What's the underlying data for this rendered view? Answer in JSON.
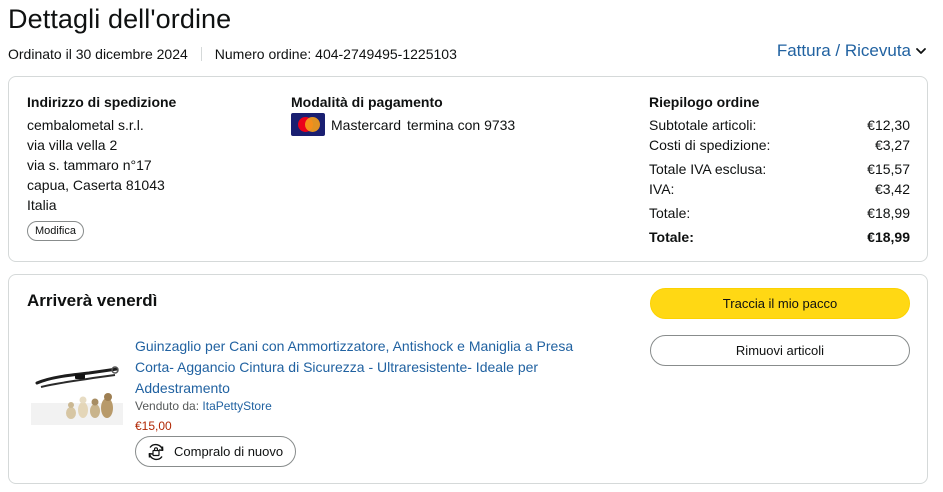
{
  "header": {
    "title": "Dettagli dell'ordine",
    "order_date": "Ordinato il 30 dicembre 2024",
    "order_number": "Numero ordine: 404-2749495-1225103",
    "invoice_link": "Fattura / Ricevuta"
  },
  "shipping": {
    "title": "Indirizzo di spedizione",
    "lines": [
      "cembalometal s.r.l.",
      "via villa vella 2",
      "via s. tammaro n°17",
      "capua, Caserta 81043",
      "Italia"
    ],
    "edit_label": "Modifica"
  },
  "payment": {
    "title": "Modalità di pagamento",
    "card_name": "Mastercard",
    "card_ending": "termina con 9733",
    "icon": "mastercard-logo"
  },
  "summary": {
    "title": "Riepilogo ordine",
    "rows": [
      {
        "label": "Subtotale articoli:",
        "value": "€12,30"
      },
      {
        "label": "Costi di spedizione:",
        "value": "€3,27"
      },
      {
        "label": "Totale IVA esclusa:",
        "value": "€15,57"
      },
      {
        "label": "IVA:",
        "value": "€3,42"
      },
      {
        "label": "Totale:",
        "value": "€18,99"
      },
      {
        "label": "Totale:",
        "value": "€18,99"
      }
    ]
  },
  "shipment": {
    "title": "Arriverà venerdì",
    "product_title": "Guinzaglio per Cani con Ammortizzatore, Antishock e Maniglia a Presa Corta- Aggancio Cintura di Sicurezza - Ultraresistente- Ideale per Addestramento",
    "sold_by_label": "Venduto da:",
    "seller": "ItaPettyStore",
    "price": "€15,00",
    "buy_again_label": "Compralo di nuovo",
    "track_label": "Traccia il mio pacco",
    "remove_label": "Rimuovi articoli"
  },
  "colors": {
    "link": "#2162a1",
    "price": "#b12704",
    "primary_button": "#ffd814",
    "border": "#d5d9d9"
  }
}
